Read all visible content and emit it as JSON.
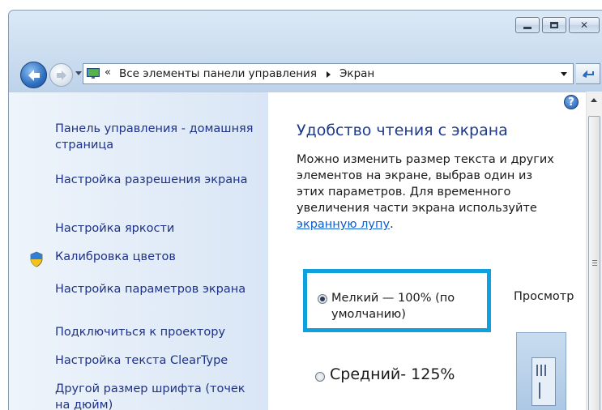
{
  "window": {
    "caption_buttons": [
      {
        "name": "minimize",
        "glyph": ""
      },
      {
        "name": "maximize",
        "glyph": ""
      },
      {
        "name": "close",
        "glyph": "✕"
      }
    ]
  },
  "address_bar": {
    "chevron": "«",
    "crumbs": [
      "Все элементы панели управления",
      "Экран"
    ],
    "icon": "monitor-icon"
  },
  "sidebar": {
    "items": [
      {
        "label": "Панель управления - домашняя страница",
        "icon": null
      },
      {
        "label": "Настройка разрешения экрана",
        "icon": null
      },
      {
        "label": "Настройка яркости",
        "icon": null
      },
      {
        "label": "Калибровка цветов",
        "icon": "shield-icon"
      },
      {
        "label": "Настройка параметров экрана",
        "icon": null
      },
      {
        "label": "Подключиться к проектору",
        "icon": null
      },
      {
        "label": "Настройка текста ClearType",
        "icon": null
      },
      {
        "label": "Другой размер шрифта (точек на дюйм)",
        "icon": null
      }
    ]
  },
  "main": {
    "help_glyph": "?",
    "title": "Удобство чтения с экрана",
    "description_before_link": "Можно изменить размер текста и других элементов на экране, выбрав один из этих параметров. Для временного увеличения части экрана используйте ",
    "magnifier_link": "экранную лупу",
    "description_after_link": ".",
    "preview_label": "Просмотр",
    "options": [
      {
        "label": "Мелкий — 100% (по умолчанию)",
        "checked": true
      },
      {
        "label": "Средний- 125%",
        "checked": false
      }
    ],
    "highlight_color": "#0ea1de"
  },
  "colors": {
    "link": "#1e3287",
    "title": "#1e3a8c",
    "inline_link": "#0c5ed1"
  }
}
